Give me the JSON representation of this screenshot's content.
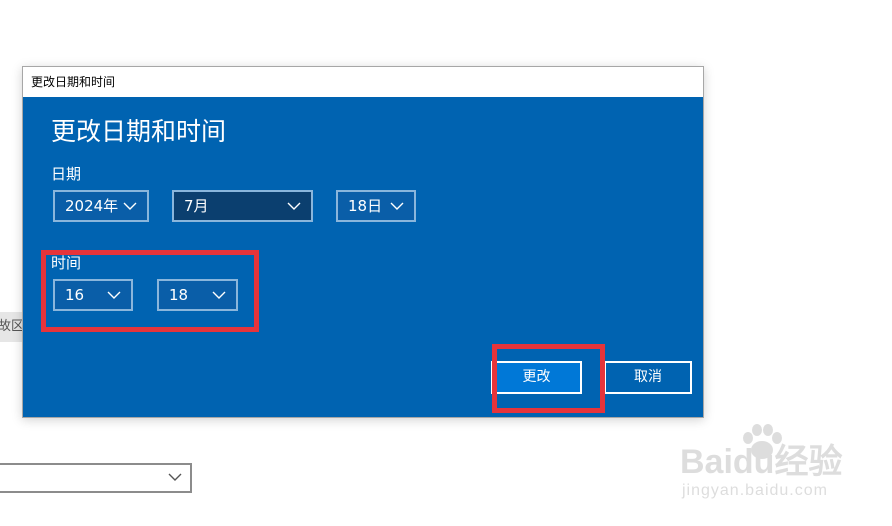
{
  "background": {
    "fragment_text": "故区"
  },
  "dialog": {
    "window_title": "更改日期和时间",
    "heading": "更改日期和时间",
    "date_label": "日期",
    "year": "2024年",
    "month": "7月",
    "day": "18日",
    "time_label": "时间",
    "hour": "16",
    "minute": "18",
    "change_button": "更改",
    "cancel_button": "取消"
  },
  "watermark": {
    "brand": "Baidu经验",
    "url": "jingyan.baidu.com"
  },
  "colors": {
    "dialog_bg": "#0063b1",
    "primary_button": "#0078d7",
    "annotation": "#e6343b"
  }
}
